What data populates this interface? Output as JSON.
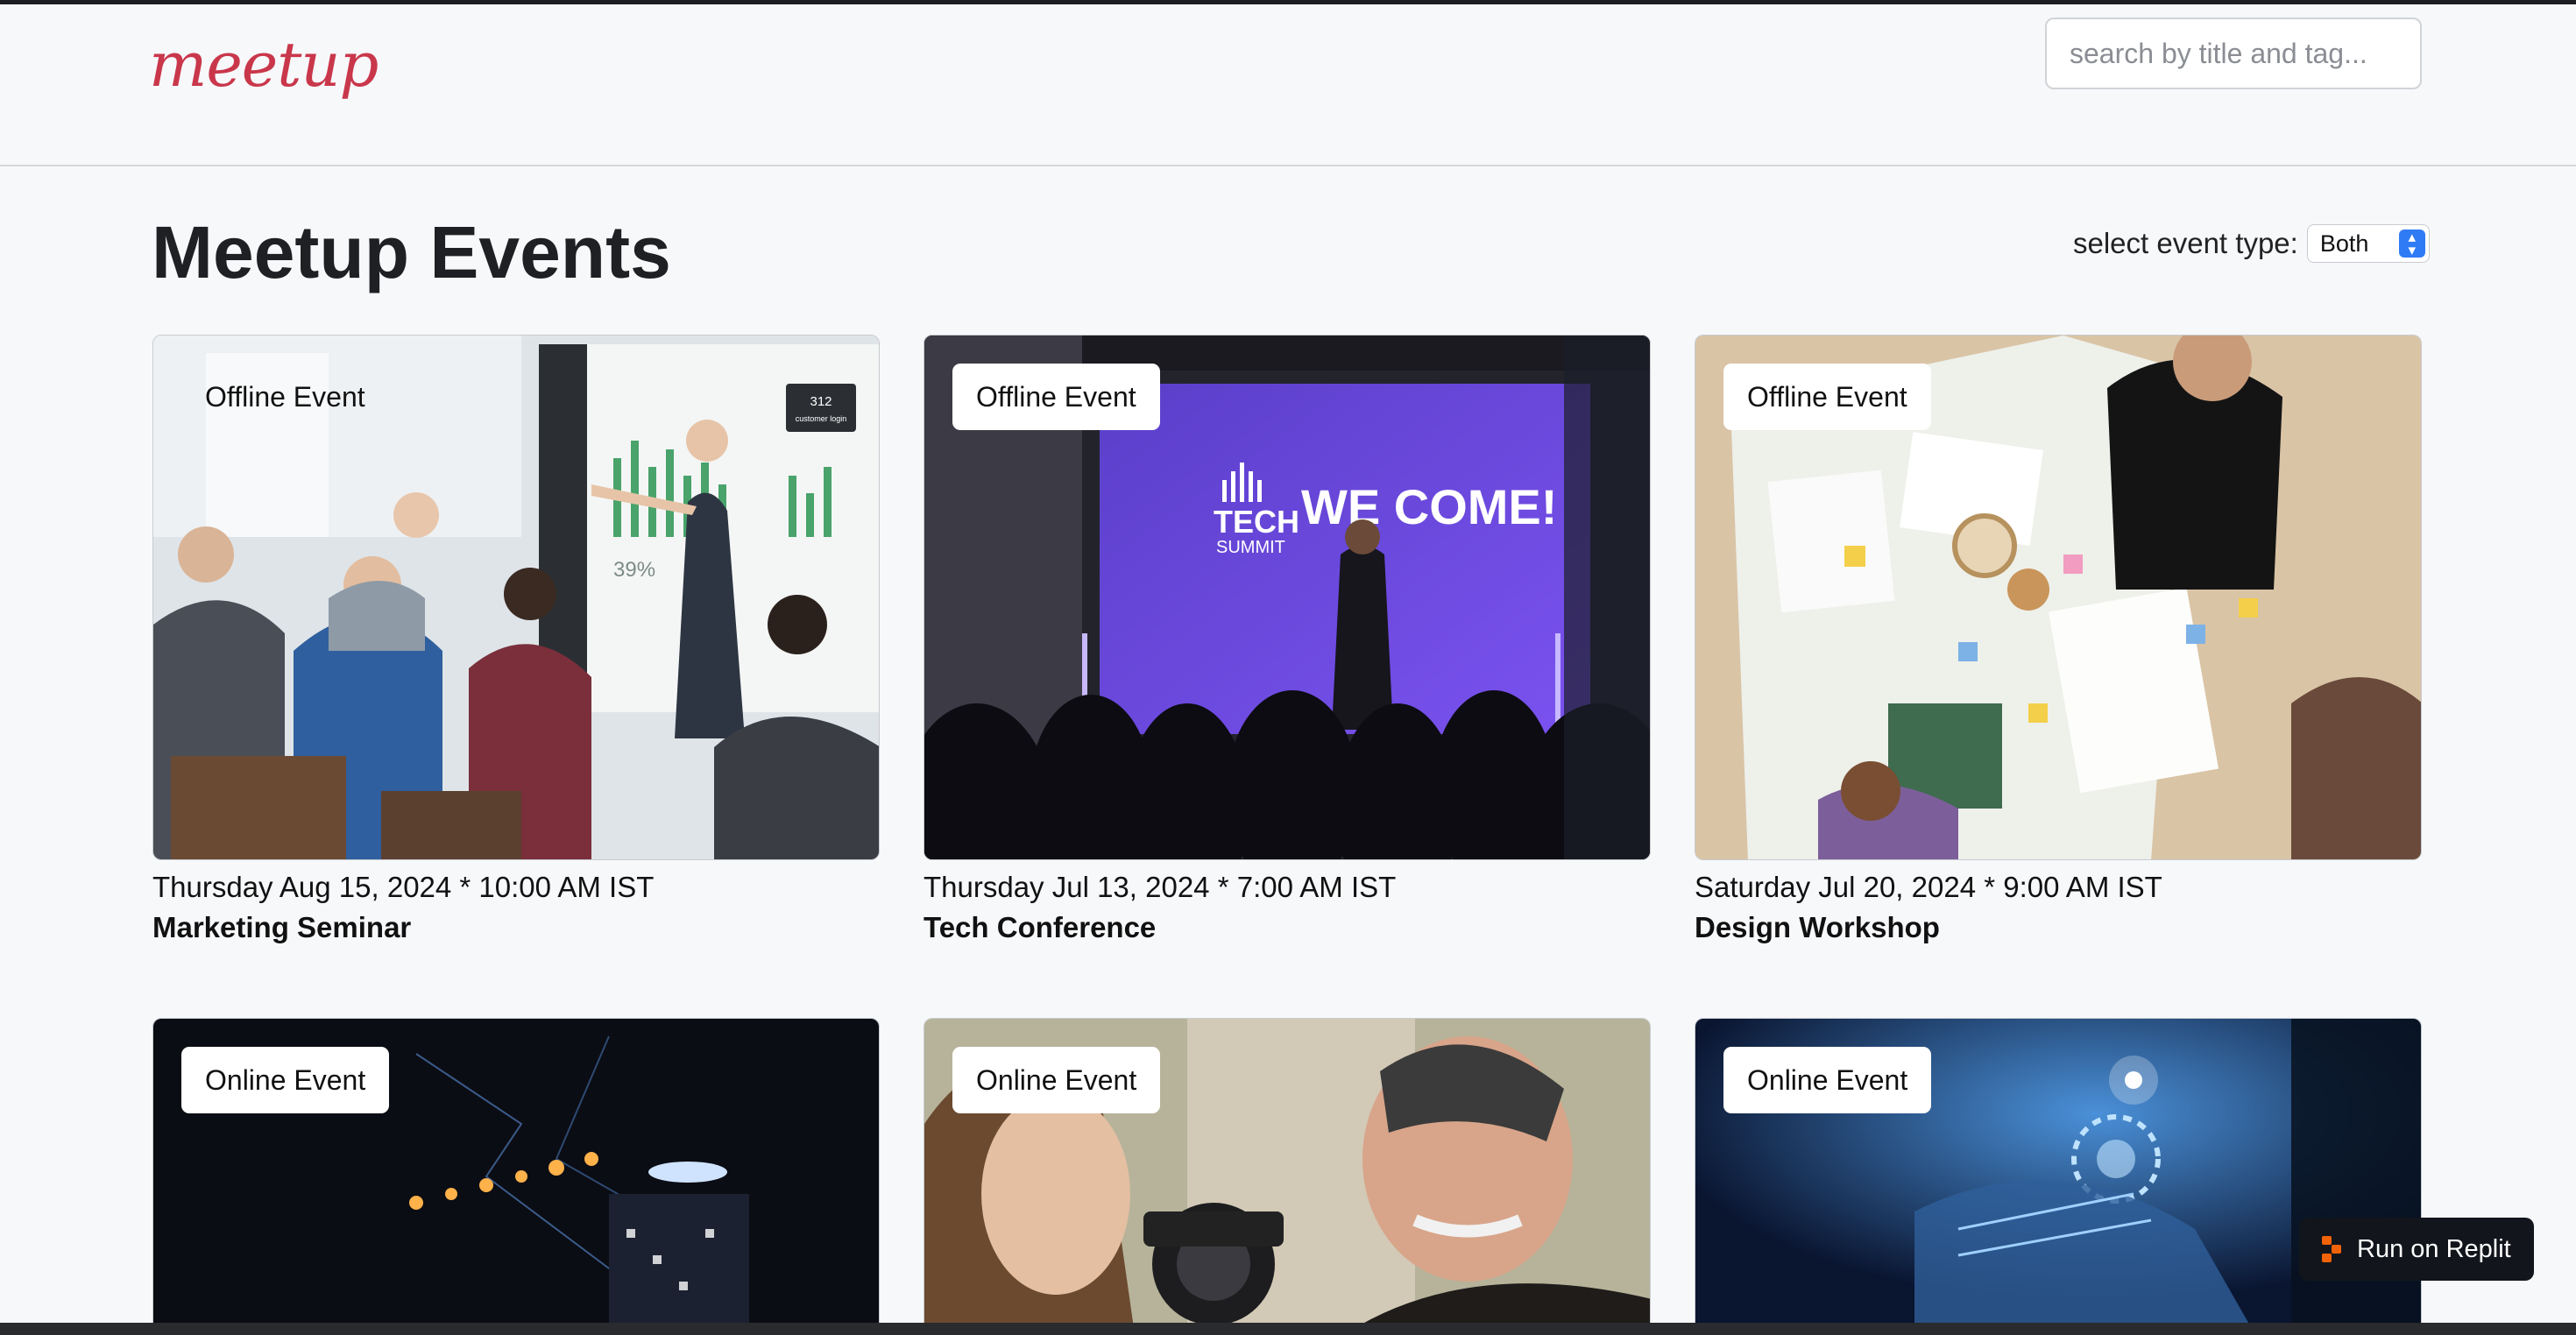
{
  "header": {
    "logo": "meetup",
    "search_placeholder": "search by title and tag..."
  },
  "page": {
    "title": "Meetup Events",
    "filter_label": "select event type:",
    "filter_value": "Both"
  },
  "events": [
    {
      "type": "Offline Event",
      "date": "Thursday Aug 15, 2024 * 10:00 AM IST",
      "title": "Marketing Seminar"
    },
    {
      "type": "Offline Event",
      "date": "Thursday Jul 13, 2024 * 7:00 AM IST",
      "title": "Tech Conference"
    },
    {
      "type": "Offline Event",
      "date": "Saturday Jul 20, 2024 * 9:00 AM IST",
      "title": "Design Workshop"
    },
    {
      "type": "Online Event"
    },
    {
      "type": "Online Event"
    },
    {
      "type": "Online Event"
    }
  ],
  "image_text": {
    "welcome": "WE COME!",
    "tech": "TECH",
    "summit": "SUMMIT",
    "stat_number": "312",
    "stat_label": "customer login",
    "percent": "39%"
  },
  "replit": {
    "label": "Run on Replit"
  },
  "colors": {
    "brand": "#c9374b",
    "select_accent": "#2f7bf5",
    "replit_orange": "#f26207"
  }
}
